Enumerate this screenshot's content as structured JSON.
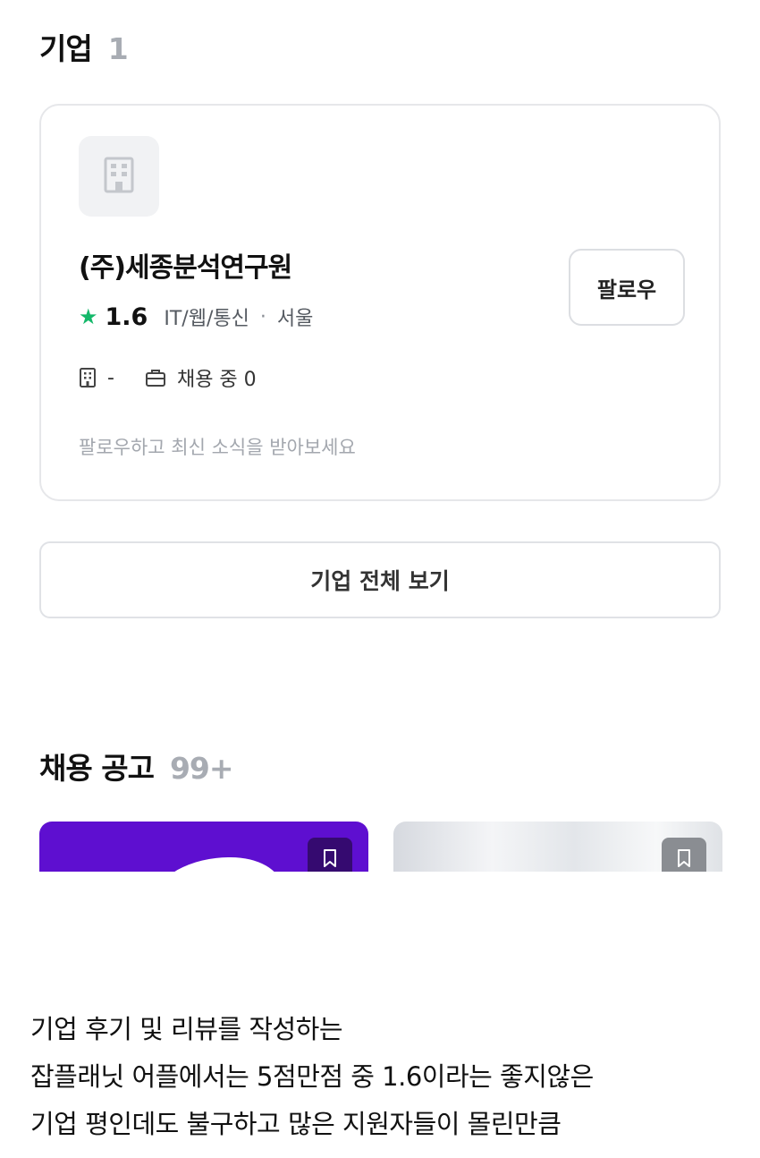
{
  "companies": {
    "title": "기업",
    "count": "1",
    "card": {
      "name": "(주)세종분석연구원",
      "rating": "1.6",
      "category": "IT/웹/통신",
      "separator": "·",
      "location": "서울",
      "employees": "-",
      "hiring": "채용 중 0",
      "follow_hint": "팔로우하고 최신 소식을 받아보세요",
      "follow_label": "팔로우"
    },
    "view_all_label": "기업 전체 보기"
  },
  "jobs": {
    "title": "채용 공고",
    "count": "99+"
  },
  "caption": {
    "lines": [
      "기업 후기 및 리뷰를 작성하는",
      "잡플래닛 어플에서는 5점만점 중 1.6이라는 좋지않은",
      "기업 평인데도 불구하고 많은 지원자들이 몰린만큼"
    ]
  },
  "colors": {
    "accent_star": "#14b86a",
    "job_card_1": "#5e0fd0",
    "muted_text": "#a3a7ae",
    "border": "#e6e7ea"
  },
  "icons": [
    "building-icon",
    "star-icon",
    "briefcase-icon",
    "bookmark-icon"
  ]
}
